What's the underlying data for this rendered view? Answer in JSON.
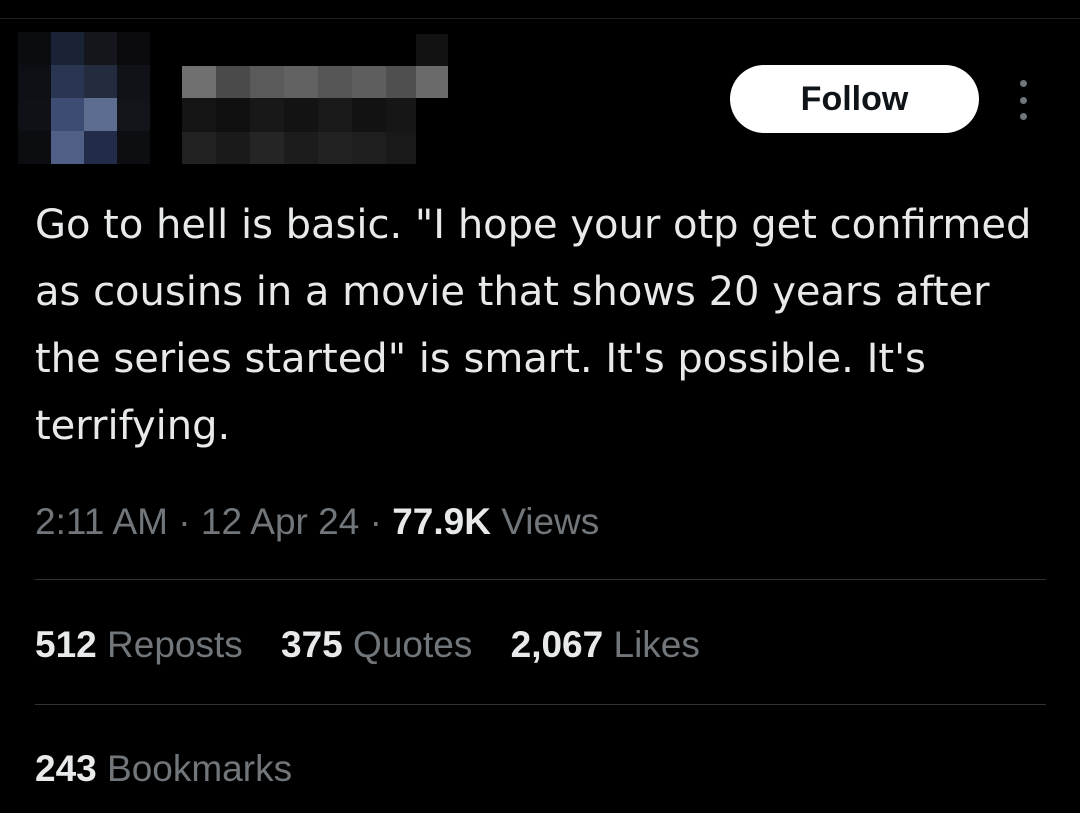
{
  "header": {
    "follow_label": "Follow",
    "more_icon": "more-vertical-icon"
  },
  "tweet": {
    "text": "Go to hell is basic. \"I hope your otp get confirmed as cousins in a movie that shows 20 years after the series started\" is smart. It's possible. It's terrifying.",
    "time": "2:11 AM",
    "date": "12 Apr 24",
    "separator": "·",
    "views_count": "77.9K",
    "views_label": "Views"
  },
  "stats": {
    "reposts_count": "512",
    "reposts_label": "Reposts",
    "quotes_count": "375",
    "quotes_label": "Quotes",
    "likes_count": "2,067",
    "likes_label": "Likes",
    "bookmarks_count": "243",
    "bookmarks_label": "Bookmarks"
  },
  "colors": {
    "background": "#000000",
    "text_primary": "#e7e9ea",
    "text_secondary": "#71767b",
    "divider": "#2f3336",
    "follow_bg": "#ffffff",
    "follow_text": "#0f1419"
  }
}
